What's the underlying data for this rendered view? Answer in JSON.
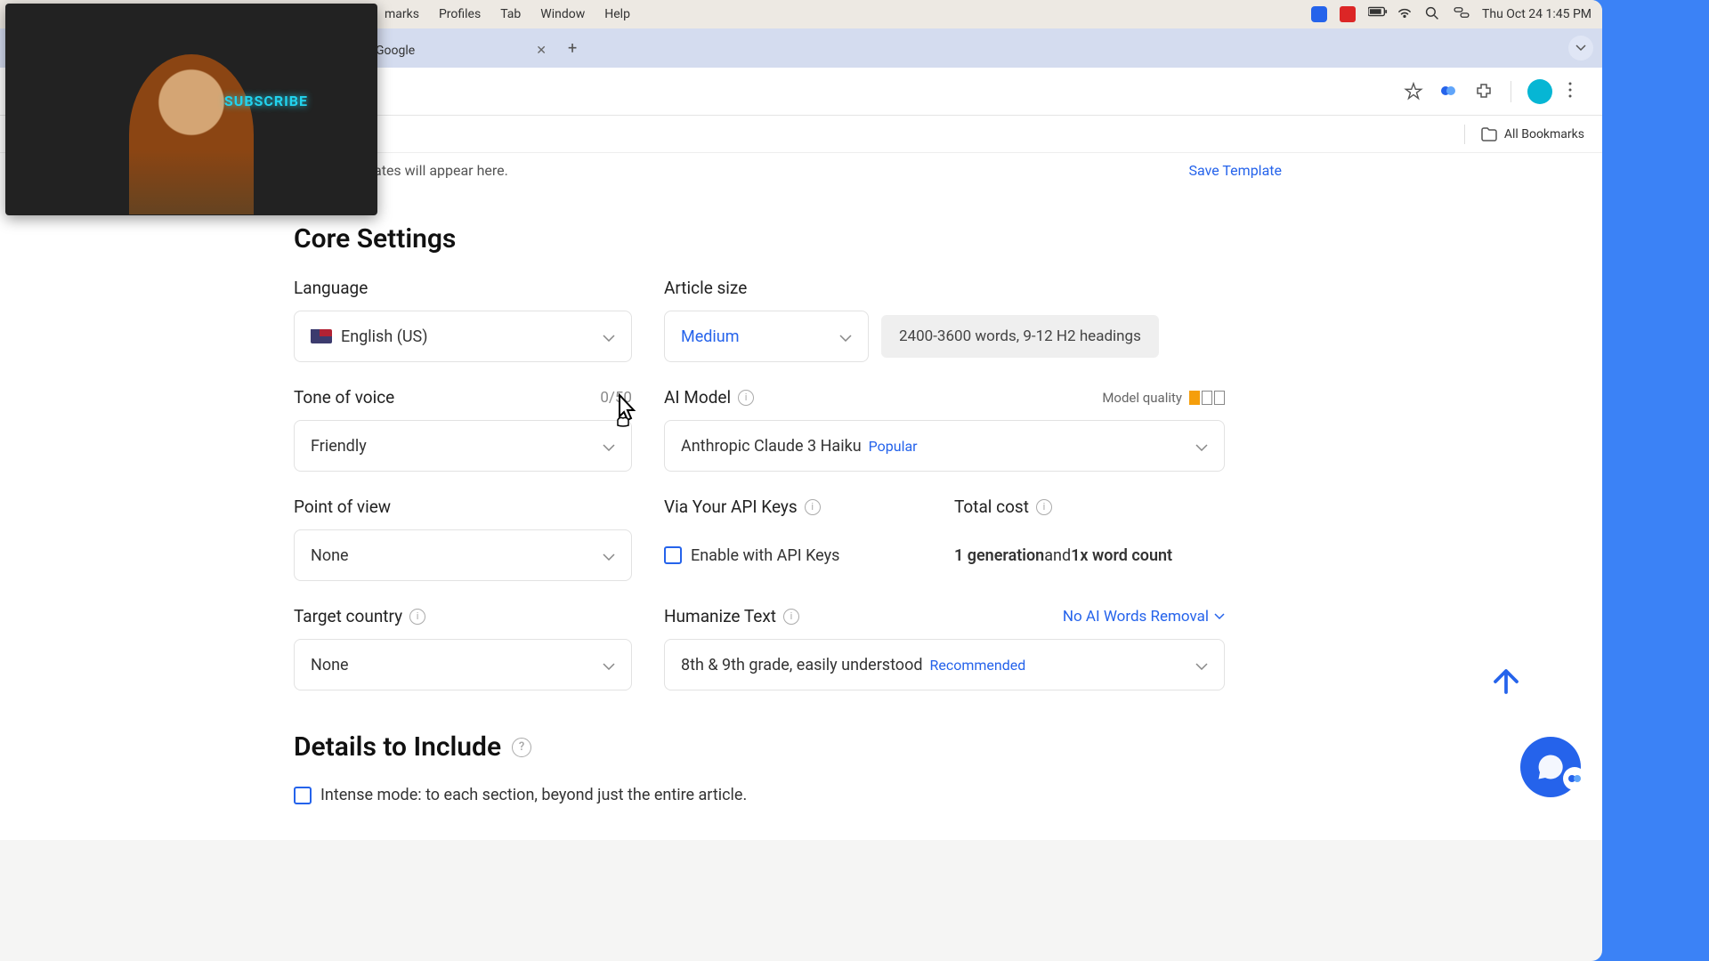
{
  "menubar": {
    "items": [
      "marks",
      "Profiles",
      "Tab",
      "Window",
      "Help"
    ],
    "clock": "Thu Oct 24  1:45 PM"
  },
  "tab": {
    "title": "Google"
  },
  "bookmarks": {
    "all": "All Bookmarks"
  },
  "topstrip": {
    "hint": "ates will appear here.",
    "save": "Save Template"
  },
  "core": {
    "title": "Core Settings",
    "language": {
      "label": "Language",
      "value": "English (US)"
    },
    "articlesize": {
      "label": "Article size",
      "value": "Medium",
      "hint": "2400-3600 words, 9-12 H2 headings"
    },
    "tone": {
      "label": "Tone of voice",
      "count": "0/50",
      "value": "Friendly"
    },
    "aimodel": {
      "label": "AI Model",
      "quality_label": "Model quality",
      "value": "Anthropic Claude 3 Haiku",
      "badge": "Popular"
    },
    "pov": {
      "label": "Point of view",
      "value": "None"
    },
    "apikeys": {
      "label": "Via Your API Keys",
      "checkbox": "Enable with API Keys"
    },
    "cost": {
      "label": "Total cost",
      "gen": "1 generation",
      "rest": " and ",
      "wc": "1x word count"
    },
    "country": {
      "label": "Target country",
      "value": "None"
    },
    "humanize": {
      "label": "Humanize Text",
      "removal": "No AI Words Removal",
      "value": "8th & 9th grade, easily understood",
      "badge": "Recommended"
    }
  },
  "details": {
    "title": "Details to Include",
    "intense": "Intense mode: to each section, beyond just the entire article."
  },
  "webcam": {
    "sub": "SUBSCRIBE"
  }
}
